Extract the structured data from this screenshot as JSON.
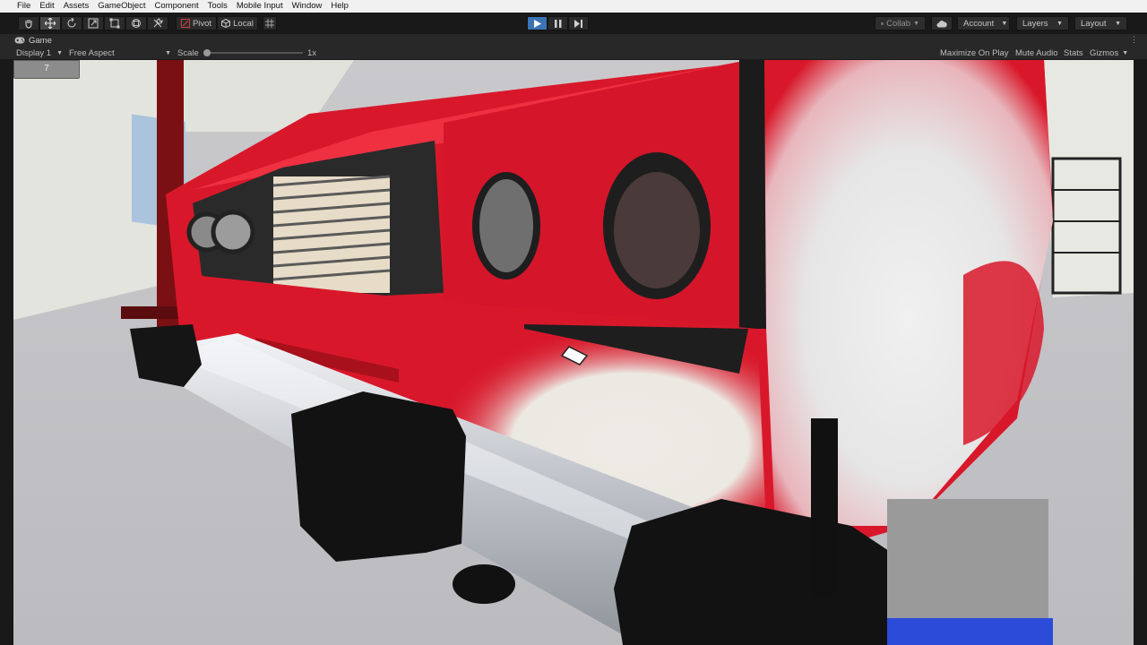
{
  "menu": [
    "File",
    "Edit",
    "Assets",
    "GameObject",
    "Component",
    "Tools",
    "Mobile Input",
    "Window",
    "Help"
  ],
  "toolbar": {
    "tools": [
      {
        "name": "hand-tool",
        "icon": "hand-icon"
      },
      {
        "name": "move-tool",
        "icon": "move-icon"
      },
      {
        "name": "rotate-tool",
        "icon": "rotate-icon"
      },
      {
        "name": "scale-tool",
        "icon": "scale-icon"
      },
      {
        "name": "rect-tool",
        "icon": "rect-icon"
      },
      {
        "name": "transform-tool",
        "icon": "transform-icon"
      },
      {
        "name": "custom-tool",
        "icon": "wrench-icon"
      }
    ],
    "pivot_label": "Pivot",
    "local_label": "Local",
    "collab_label": "Collab",
    "account_label": "Account",
    "layers_label": "Layers",
    "layout_label": "Layout",
    "play_state": "playing"
  },
  "game_tab": {
    "title": "Game",
    "display": "Display 1",
    "aspect": "Free Aspect",
    "scale_label": "Scale",
    "scale_value": "1x",
    "maximize": "Maximize On Play",
    "mute": "Mute Audio",
    "stats": "Stats",
    "gizmos": "Gizmos"
  },
  "game_ui": {
    "counter": "7"
  },
  "colors": {
    "accent_play": "#3b74b5",
    "car_red": "#d8182a",
    "car_white": "#e8e5df",
    "bumper_chrome": "#bfc3c9"
  }
}
